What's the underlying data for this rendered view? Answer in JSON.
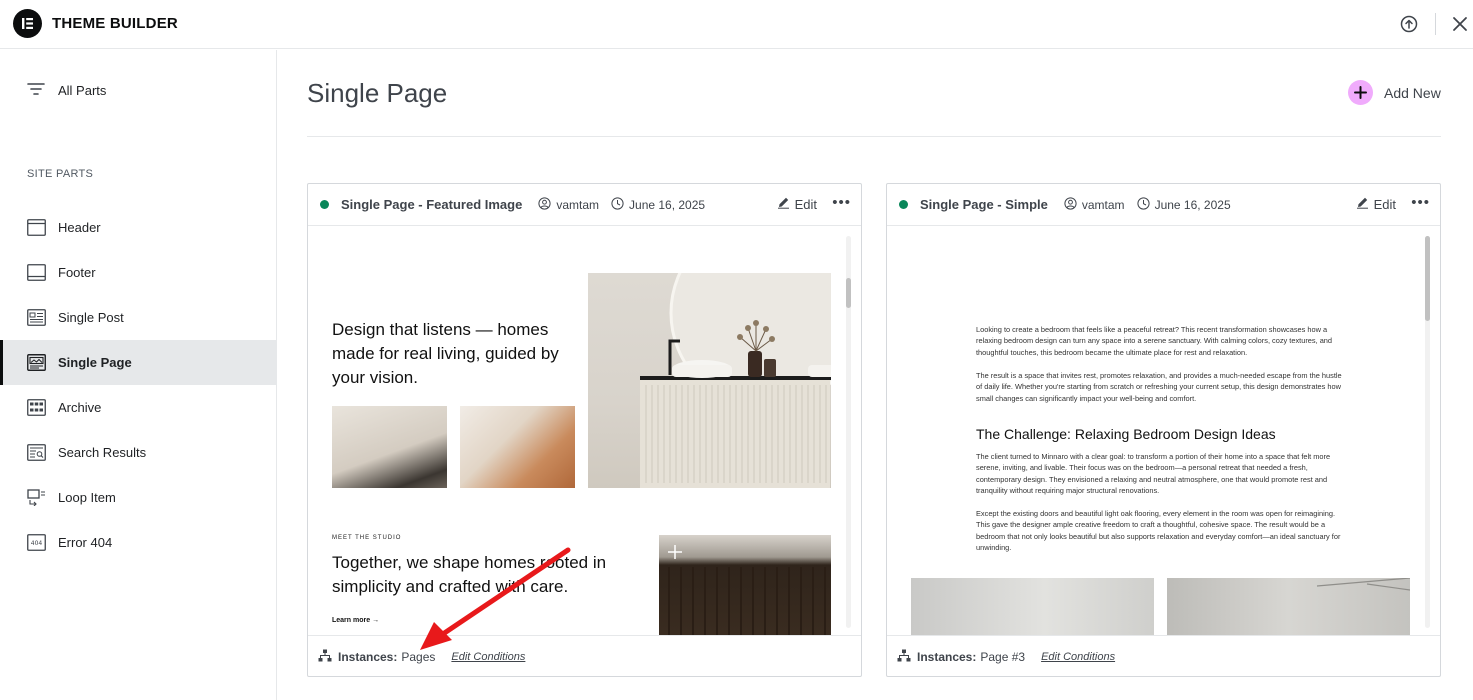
{
  "app": {
    "title": "THEME BUILDER",
    "logo_icon": "elementor-logo-icon"
  },
  "sidebar": {
    "all_parts_label": "All Parts",
    "section_label": "SITE PARTS",
    "items": [
      {
        "label": "Header",
        "icon": "header-icon",
        "active": false
      },
      {
        "label": "Footer",
        "icon": "footer-icon",
        "active": false
      },
      {
        "label": "Single Post",
        "icon": "single-post-icon",
        "active": false
      },
      {
        "label": "Single Page",
        "icon": "single-page-icon",
        "active": true
      },
      {
        "label": "Archive",
        "icon": "archive-icon",
        "active": false
      },
      {
        "label": "Search Results",
        "icon": "search-results-icon",
        "active": false
      },
      {
        "label": "Loop Item",
        "icon": "loop-item-icon",
        "active": false
      },
      {
        "label": "Error 404",
        "icon": "error-404-icon",
        "active": false
      }
    ]
  },
  "main": {
    "title": "Single Page",
    "add_new_label": "Add New",
    "accent_color": "#f0abfc"
  },
  "cards": [
    {
      "title": "Single Page - Featured Image",
      "author": "vamtam",
      "date": "June 16, 2025",
      "edit_label": "Edit",
      "status_color": "#0a875a",
      "instances_label": "Instances:",
      "instances_value": "Pages",
      "edit_conditions_label": "Edit Conditions",
      "preview": {
        "heading": "Design that listens — homes made for real living, guided by your vision.",
        "kicker": "MEET THE STUDIO",
        "heading2": "Together, we shape homes rooted in simplicity and crafted with care.",
        "learn_more": "Learn more →"
      }
    },
    {
      "title": "Single Page - Simple",
      "author": "vamtam",
      "date": "June 16, 2025",
      "edit_label": "Edit",
      "status_color": "#0a875a",
      "instances_label": "Instances:",
      "instances_value": "Page #3",
      "edit_conditions_label": "Edit Conditions",
      "preview": {
        "para1": "Looking to create a bedroom that feels like a peaceful retreat? This recent transformation showcases how a relaxing bedroom design can turn any space into a serene sanctuary. With calming colors, cozy textures, and thoughtful touches, this bedroom became the ultimate place for rest and relaxation.",
        "para2": "The result is a space that invites rest, promotes relaxation, and provides a much-needed escape from the hustle of daily life. Whether you're starting from scratch or refreshing your current setup, this design demonstrates how small changes can significantly impact your well-being and comfort.",
        "heading": "The Challenge: Relaxing Bedroom Design Ideas",
        "para3": "The client turned to Minnaro with a clear goal: to transform a portion of their home into a space that felt more serene, inviting, and livable. Their focus was on the bedroom—a personal retreat that needed a fresh, contemporary design. They envisioned a relaxing and neutral atmosphere, one that would promote rest and tranquility without requiring major structural renovations.",
        "para4": "Except the existing doors and beautiful light oak flooring, every element in the room was open for reimagining. This gave the designer ample creative freedom to craft a thoughtful, cohesive space. The result would be a bedroom that not only looks beautiful but also supports relaxation and everyday comfort—an ideal sanctuary for unwinding."
      }
    }
  ],
  "annotation": {
    "arrow_color": "#e8191b"
  }
}
